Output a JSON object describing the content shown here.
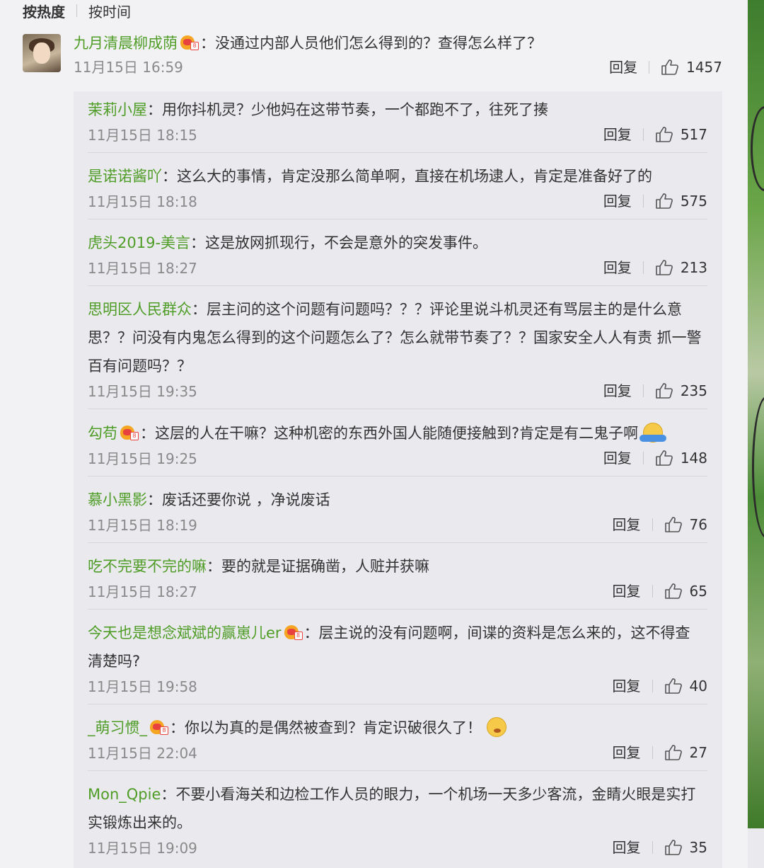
{
  "sort": {
    "hot": "按热度",
    "time": "按时间"
  },
  "main": {
    "user": "九月清晨柳成荫",
    "text": "：没通过内部人员他们怎么得到的？查得怎么样了？",
    "time": "11月15日 16:59",
    "reply_label": "回复",
    "likes": "1457"
  },
  "replies": [
    {
      "user": "茉莉小屋",
      "vip": false,
      "lines": [
        "：用你抖机灵？少他妈在这带节奏，一个都跑不了，往死了揍"
      ],
      "emoji": "",
      "time": "11月15日 18:15",
      "reply_label": "回复",
      "likes": "517"
    },
    {
      "user": "是诺诺酱吖",
      "vip": false,
      "lines": [
        "：这么大的事情，肯定没那么简单啊，直接在机场逮人，肯定是准备好了的"
      ],
      "emoji": "",
      "time": "11月15日 18:18",
      "reply_label": "回复",
      "likes": "575"
    },
    {
      "user": "虎头2019-美言",
      "vip": false,
      "lines": [
        "：这是放网抓现行，不会是意外的突发事件。"
      ],
      "emoji": "",
      "time": "11月15日 18:27",
      "reply_label": "回复",
      "likes": "213"
    },
    {
      "user": "思明区人民群众",
      "vip": false,
      "lines": [
        "：层主问的这个问题有问题吗？？？评论里说斗机灵还有骂层主的是什么意",
        "思？？问没有内鬼怎么得到的这个问题怎么了？怎么就带节奏了？？国家安全人人有责 抓一警",
        "百有问题吗？？"
      ],
      "emoji": "",
      "time": "11月15日 19:35",
      "reply_label": "回复",
      "likes": "235"
    },
    {
      "user": "勾苟",
      "vip": true,
      "lines": [
        "：这层的人在干嘛？这种机密的东西外国人能随便接触到?肯定是有二鬼子啊"
      ],
      "emoji": "shrug-emoji",
      "time": "11月15日 19:25",
      "reply_label": "回复",
      "likes": "148"
    },
    {
      "user": "慕小黑影",
      "vip": false,
      "lines": [
        "：废话还要你说 ，净说废话"
      ],
      "emoji": "",
      "time": "11月15日 18:19",
      "reply_label": "回复",
      "likes": "76"
    },
    {
      "user": "吃不完要不完的嘛",
      "vip": false,
      "lines": [
        "：要的就是证据确凿，人赃并获嘛"
      ],
      "emoji": "",
      "time": "11月15日 18:27",
      "reply_label": "回复",
      "likes": "65"
    },
    {
      "user": "今天也是想念斌斌的赢崽儿er",
      "vip": true,
      "lines": [
        "：层主说的没有问题啊，间谍的资料是怎么来的，这不得查",
        "清楚吗?"
      ],
      "emoji": "",
      "time": "11月15日 19:58",
      "reply_label": "回复",
      "likes": "40"
    },
    {
      "user": "_萌习惯_",
      "vip": true,
      "lines": [
        "：你以为真的是偶然被查到？肯定识破很久了！"
      ],
      "emoji": "shush-emoji",
      "time": "11月15日 22:04",
      "reply_label": "回复",
      "likes": "27"
    },
    {
      "user": "Mon_Qpie",
      "vip": false,
      "lines": [
        "：不要小看海关和边检工作人员的眼力，一个机场一天多少客流，金睛火眼是实打",
        "实锻炼出来的。"
      ],
      "emoji": "",
      "time": "11月15日 19:09",
      "reply_label": "回复",
      "likes": "35"
    }
  ]
}
